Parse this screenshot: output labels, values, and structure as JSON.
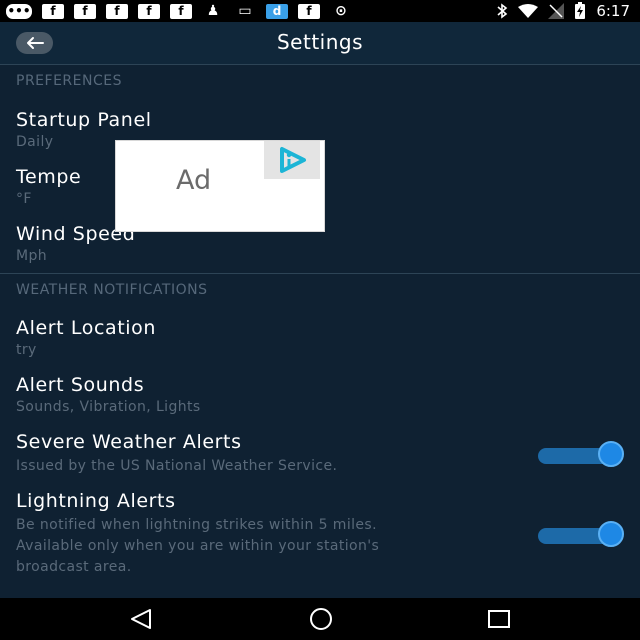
{
  "status_bar": {
    "time": "6:17",
    "icons": [
      "message-icon",
      "facebook-icon",
      "facebook-icon",
      "facebook-icon",
      "facebook-icon",
      "facebook-icon",
      "person-icon",
      "screen-icon",
      "d-app-icon",
      "facebook-icon",
      "circle-icon",
      "bluetooth-icon",
      "wifi-icon",
      "no-signal-icon",
      "battery-charging-icon"
    ]
  },
  "header": {
    "title": "Settings"
  },
  "sections": {
    "preferences": {
      "label": "PREFERENCES",
      "startup_panel": {
        "title": "Startup Panel",
        "value": "Daily"
      },
      "temperature": {
        "title": "Tempe",
        "value": "°F"
      },
      "wind_speed": {
        "title": "Wind Speed",
        "value": "Mph"
      }
    },
    "notifications": {
      "label": "WEATHER NOTIFICATIONS",
      "alert_location": {
        "title": "Alert Location",
        "value": "try"
      },
      "alert_sounds": {
        "title": "Alert Sounds",
        "value": "Sounds, Vibration, Lights"
      },
      "severe_weather": {
        "title": "Severe Weather Alerts",
        "description": "Issued by the US National Weather Service.",
        "enabled": true
      },
      "lightning": {
        "title": "Lightning Alerts",
        "description_line1": "Be notified when lightning strikes within 5 miles.",
        "description_line2": "Available only when you are within your station's",
        "description_line3": "broadcast area.",
        "enabled": true
      }
    }
  },
  "ad": {
    "label": "Ad"
  },
  "colors": {
    "background": "#0f2132",
    "toggle_on": "#1e88e5",
    "ad_logo": "#1cb5d6"
  }
}
